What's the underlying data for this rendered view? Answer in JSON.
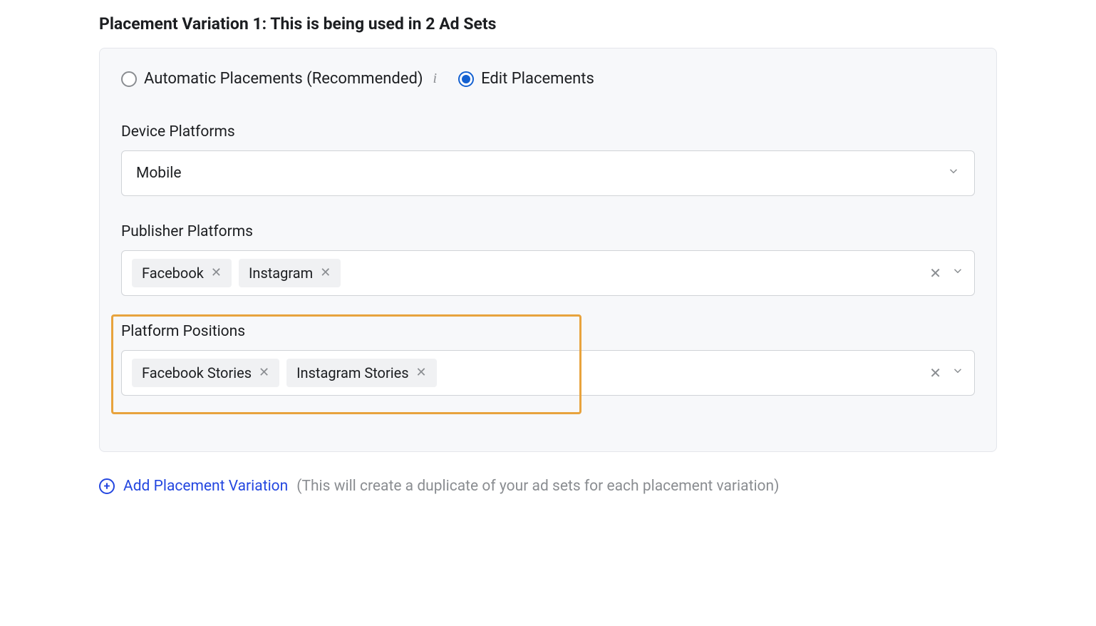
{
  "heading": "Placement Variation 1: This is being used in 2 Ad Sets",
  "placement_mode": {
    "automatic_label": "Automatic Placements (Recommended)",
    "edit_label": "Edit Placements",
    "selected": "edit"
  },
  "device_platforms": {
    "label": "Device Platforms",
    "value": "Mobile"
  },
  "publisher_platforms": {
    "label": "Publisher Platforms",
    "tags": [
      "Facebook",
      "Instagram"
    ]
  },
  "platform_positions": {
    "label": "Platform Positions",
    "tags": [
      "Facebook Stories",
      "Instagram Stories"
    ]
  },
  "footer": {
    "link": "Add Placement Variation",
    "hint": "(This will create a duplicate of your ad sets for each placement variation)"
  }
}
